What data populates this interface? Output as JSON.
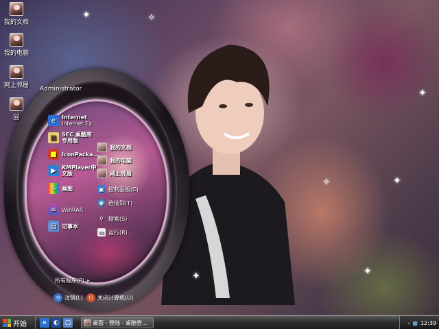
{
  "desktop": {
    "icons": [
      {
        "label": "我的文档"
      },
      {
        "label": "我的电脑"
      },
      {
        "label": "网上邻居"
      },
      {
        "label": "回"
      }
    ]
  },
  "start_menu": {
    "user": "Administrator",
    "pinned": [
      {
        "line1": "Internet",
        "line2": "Internet Ex",
        "icon": "ie-icon"
      },
      {
        "line1": "SEC 桌酷库",
        "line2": "专用版",
        "icon": "sec-icon"
      },
      {
        "line1": "IconPacka...",
        "line2": "",
        "icon": "iconpackager-icon"
      },
      {
        "line1": "KMPlayer中",
        "line2": "文版",
        "icon": "kmplayer-icon"
      },
      {
        "line1": "画图",
        "line2": "",
        "icon": "paint-icon"
      },
      {
        "line1": "WinRAR",
        "line2": "",
        "icon": "winrar-icon"
      },
      {
        "line1": "记事本",
        "line2": "",
        "icon": "notepad-icon"
      }
    ],
    "all_programs": "所有程序(P)",
    "places": [
      {
        "label": "我的文档"
      },
      {
        "label": "我的电脑"
      },
      {
        "label": "网上邻居"
      }
    ],
    "system": [
      {
        "label": "控制面板(C)",
        "icon": "control-panel-icon"
      },
      {
        "label": "连接到(T)",
        "icon": "connect-icon"
      },
      {
        "label": "搜索(S)",
        "icon": "search-icon"
      },
      {
        "label": "运行(R)...",
        "icon": "run-icon"
      }
    ],
    "logoff": "注销(L)",
    "shutdown": "关闭计算机(U)"
  },
  "taskbar": {
    "start_label": "开始",
    "task_label": "桌面 - 登陆 - 桌酷登...",
    "clock": "12:39"
  },
  "colors": {
    "start_ring": "#d8a8cc",
    "taskbar": "#2e2e2e"
  }
}
